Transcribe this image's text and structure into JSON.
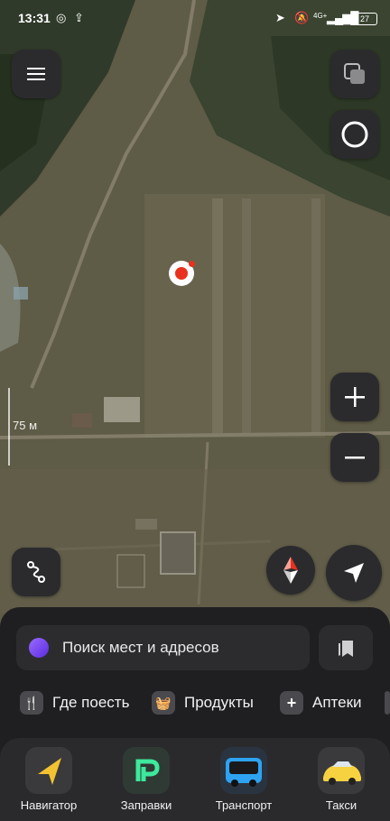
{
  "status_bar": {
    "time": "13:31",
    "network": "4G+",
    "battery": "27"
  },
  "map": {
    "scale_label": "75 м"
  },
  "search": {
    "placeholder": "Поиск мест и адресов"
  },
  "categories": [
    {
      "icon": "fork-knife-icon",
      "label": "Где поесть"
    },
    {
      "icon": "basket-icon",
      "label": "Продукты"
    },
    {
      "icon": "plus-cross-icon",
      "label": "Аптеки"
    }
  ],
  "apps": [
    {
      "icon": "navigator-arrow-icon",
      "label": "Навигатор"
    },
    {
      "icon": "refuel-logo-icon",
      "label": "Заправки"
    },
    {
      "icon": "bus-icon",
      "label": "Транспорт"
    },
    {
      "icon": "taxi-car-icon",
      "label": "Такси"
    }
  ],
  "colors": {
    "sheet": "#1f1f21",
    "control": "#2b2b2e",
    "pin": "#e8321e",
    "alice": "#7a4cf0"
  }
}
